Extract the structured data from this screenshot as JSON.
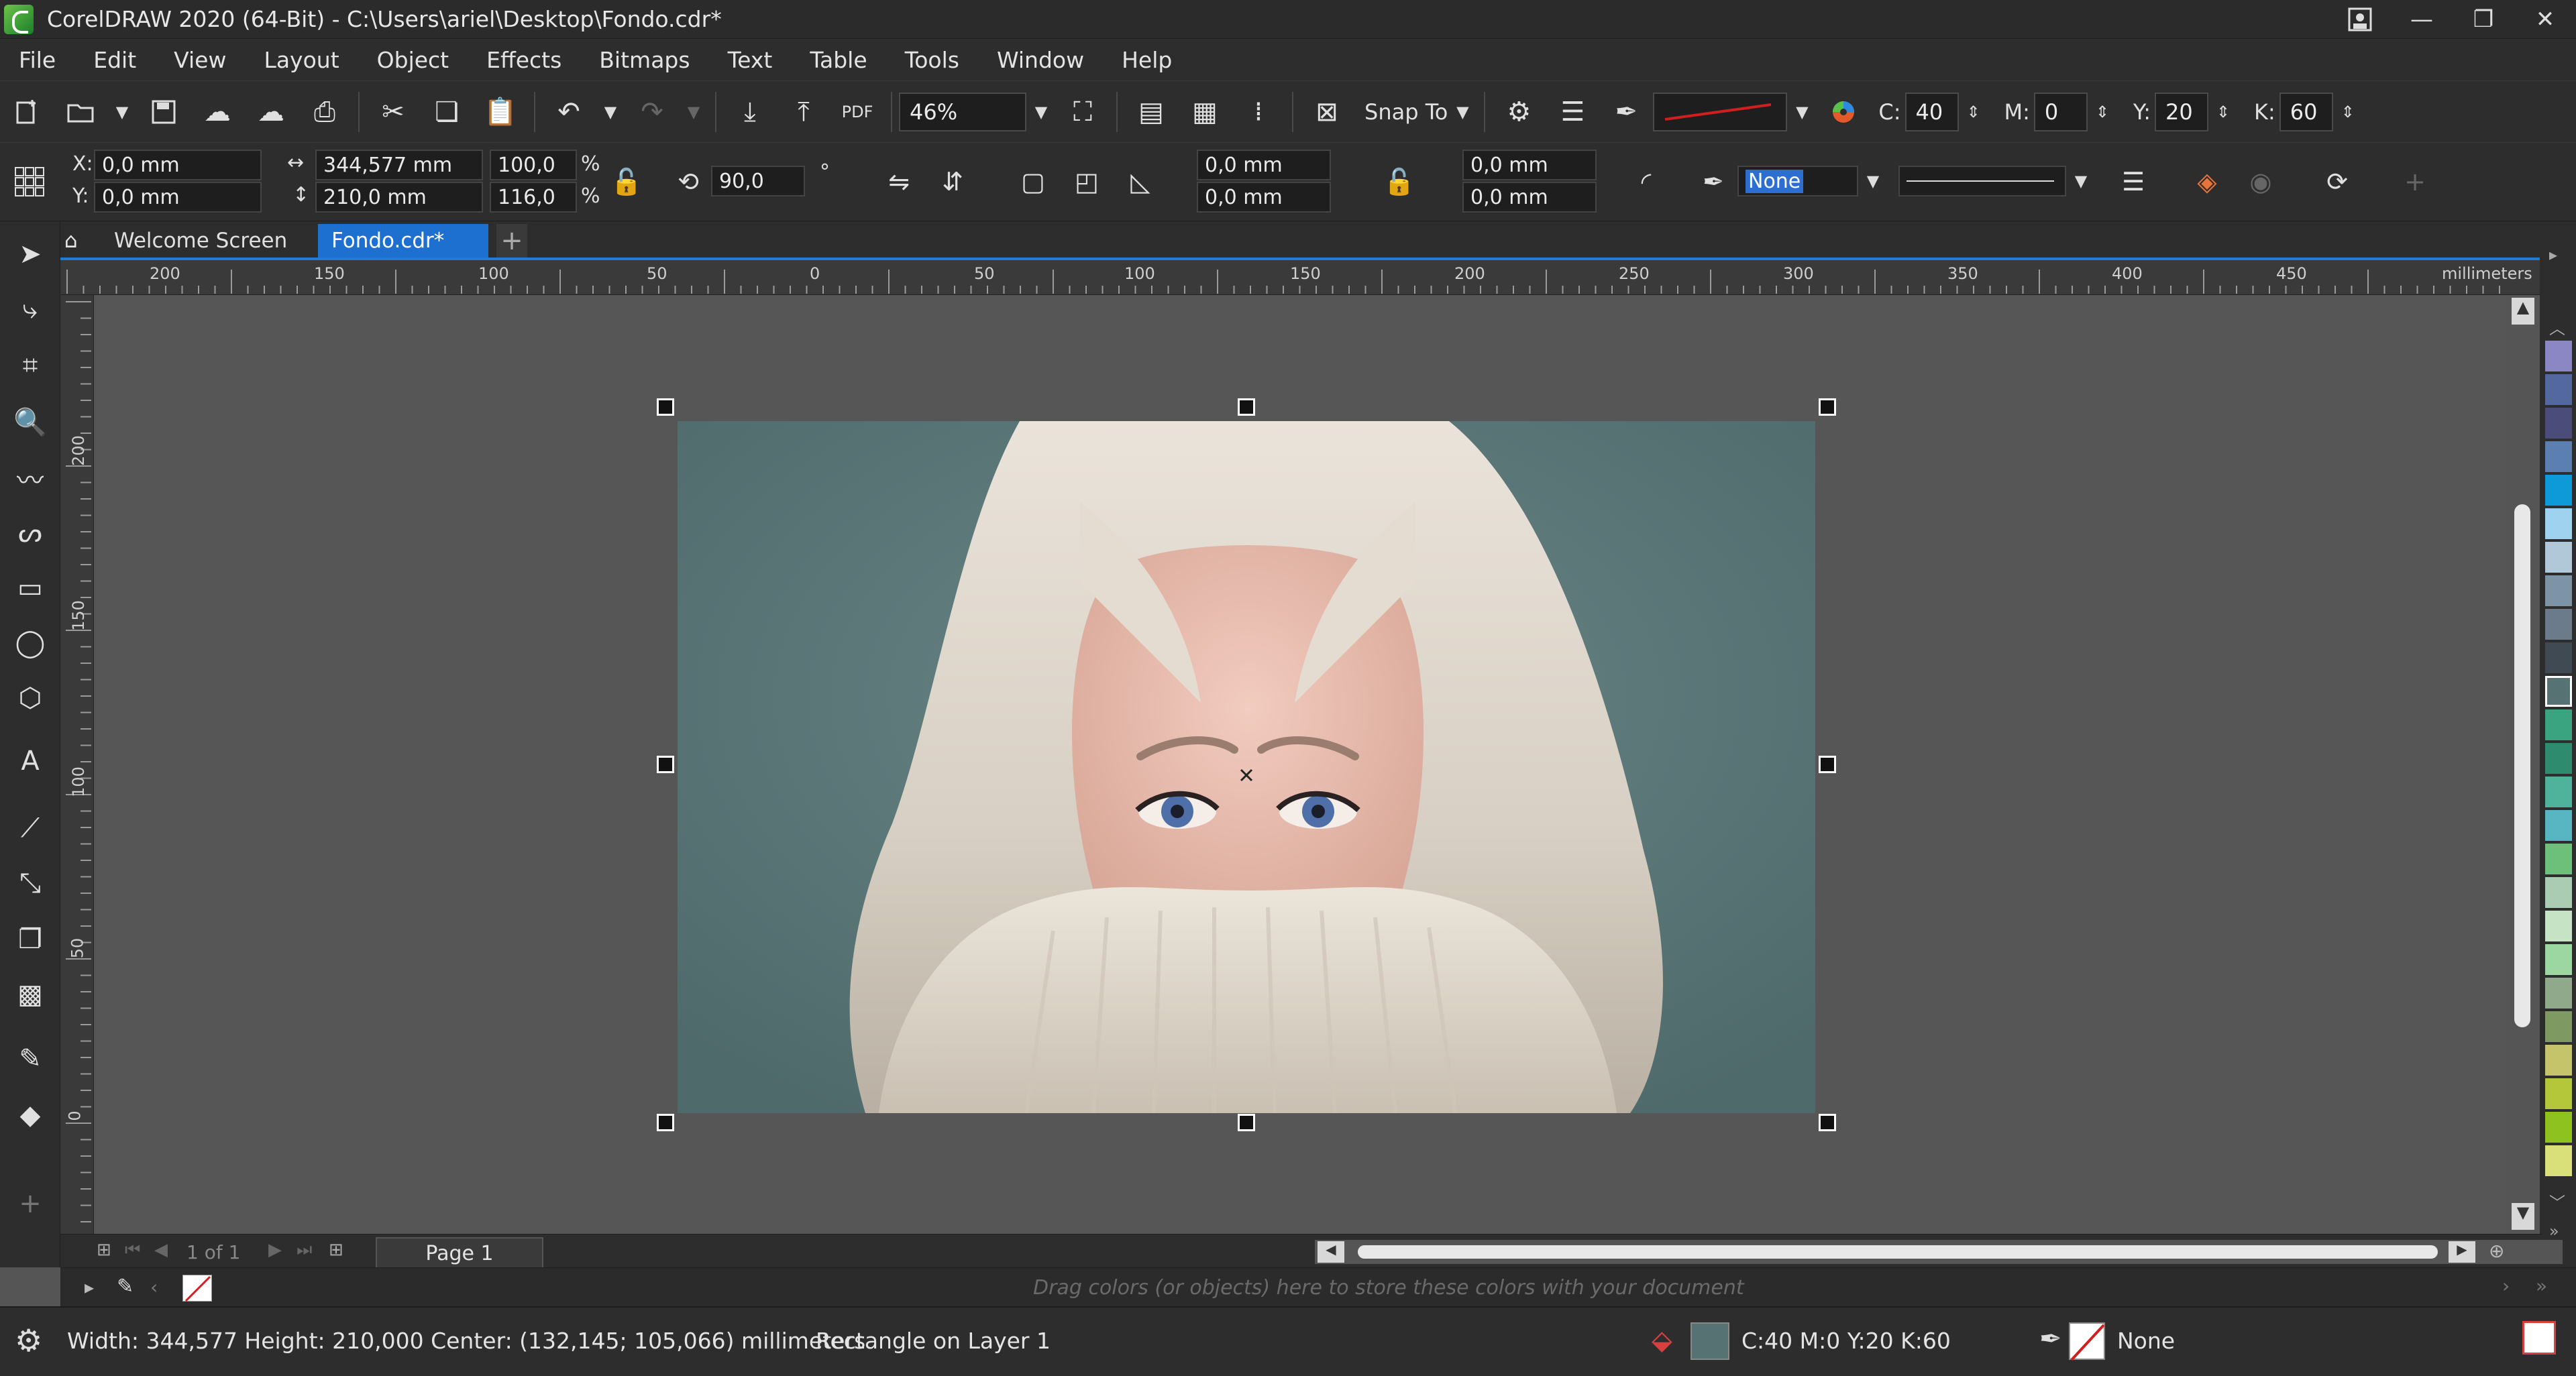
{
  "app": {
    "title": "CorelDRAW 2020 (64-Bit) - C:\\Users\\ariel\\Desktop\\Fondo.cdr*",
    "window_controls": [
      "minimize",
      "restore",
      "close"
    ]
  },
  "menu": [
    "File",
    "Edit",
    "View",
    "Layout",
    "Object",
    "Effects",
    "Bitmaps",
    "Text",
    "Table",
    "Tools",
    "Window",
    "Help"
  ],
  "toolbar": {
    "zoom": "46%",
    "snap_to": "Snap To",
    "pdf_label": "PDF",
    "cmyk": {
      "c_label": "C:",
      "c": "40",
      "m_label": "M:",
      "m": "0",
      "y_label": "Y:",
      "y": "20",
      "k_label": "K:",
      "k": "60"
    },
    "outline_color": "#d11e1e"
  },
  "propbar": {
    "x_label": "X:",
    "x": "0,0 mm",
    "y_label": "Y:",
    "y": "0,0 mm",
    "width": "344,577 mm",
    "height": "210,0 mm",
    "scale_w": "100,0",
    "scale_h": "116,0",
    "percent": "%",
    "rotation": "90,0",
    "degree": "°",
    "corner1": "0,0 mm",
    "corner2": "0,0 mm",
    "corner3": "0,0 mm",
    "corner4": "0,0 mm",
    "outline_width": "None"
  },
  "tabs": {
    "welcome": "Welcome Screen",
    "doc": "Fondo.cdr*",
    "add": "+"
  },
  "ruler": {
    "units": "millimeters",
    "h_ticks": [
      "200",
      "150",
      "100",
      "50",
      "0",
      "50",
      "100",
      "150",
      "200",
      "250",
      "300",
      "350",
      "400",
      "450"
    ],
    "v_ticks": [
      "200",
      "150",
      "100",
      "50",
      "0"
    ]
  },
  "pagenav": {
    "page_of": "1  of  1",
    "page_tab": "Page 1"
  },
  "docpalette": {
    "hint": "Drag colors (or objects) here to store these colors with your document"
  },
  "status": {
    "dimensions": "Width: 344,577  Height: 210,000  Center: (132,145; 105,066)  millimeters",
    "object": "Rectangle on Layer 1",
    "fill": "C:40 M:0 Y:20 K:60",
    "fill_color": "#577273",
    "outline": "None"
  },
  "palette_colors": [
    "#8b86c4",
    "#5468a0",
    "#4c4c7a",
    "#5b7fb0",
    "#0e9ad8",
    "#9fd2ee",
    "#b0c8d8",
    "#7d93a6",
    "#6b7b89",
    "#3f4a52",
    "#577273",
    "#3aa37f",
    "#2f8b6e",
    "#4fb29a",
    "#58b6c2",
    "#6cc07a",
    "#a9ccb2",
    "#c7e3c6",
    "#9cd6a0",
    "#8fa98a",
    "#7e9a62",
    "#c6c46a",
    "#b4c63a",
    "#8dc21f",
    "#d9e07a"
  ]
}
